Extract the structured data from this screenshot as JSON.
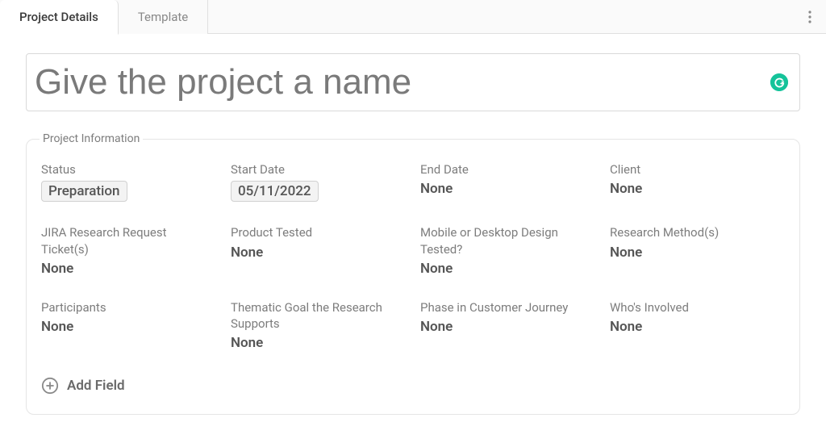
{
  "tabs": {
    "project_details": "Project Details",
    "template": "Template"
  },
  "title": {
    "placeholder": "Give the project a name",
    "value": ""
  },
  "section": {
    "legend": "Project Information",
    "add_field_label": "Add Field"
  },
  "fields": {
    "status": {
      "label": "Status",
      "value": "Preparation"
    },
    "start_date": {
      "label": "Start Date",
      "value": "05/11/2022"
    },
    "end_date": {
      "label": "End Date",
      "value": "None"
    },
    "client": {
      "label": "Client",
      "value": "None"
    },
    "jira": {
      "label": "JIRA Research Request Ticket(s)",
      "value": "None"
    },
    "product_tested": {
      "label": "Product Tested",
      "value": "None"
    },
    "mobile_desktop": {
      "label": "Mobile or Desktop Design Tested?",
      "value": "None"
    },
    "research_method": {
      "label": "Research Method(s)",
      "value": "None"
    },
    "participants": {
      "label": "Participants",
      "value": "None"
    },
    "thematic_goal": {
      "label": "Thematic Goal the Research Supports",
      "value": "None"
    },
    "phase_journey": {
      "label": "Phase in Customer Journey",
      "value": "None"
    },
    "whos_involved": {
      "label": "Who's Involved",
      "value": "None"
    }
  },
  "icons": {
    "grammarly": "G"
  }
}
